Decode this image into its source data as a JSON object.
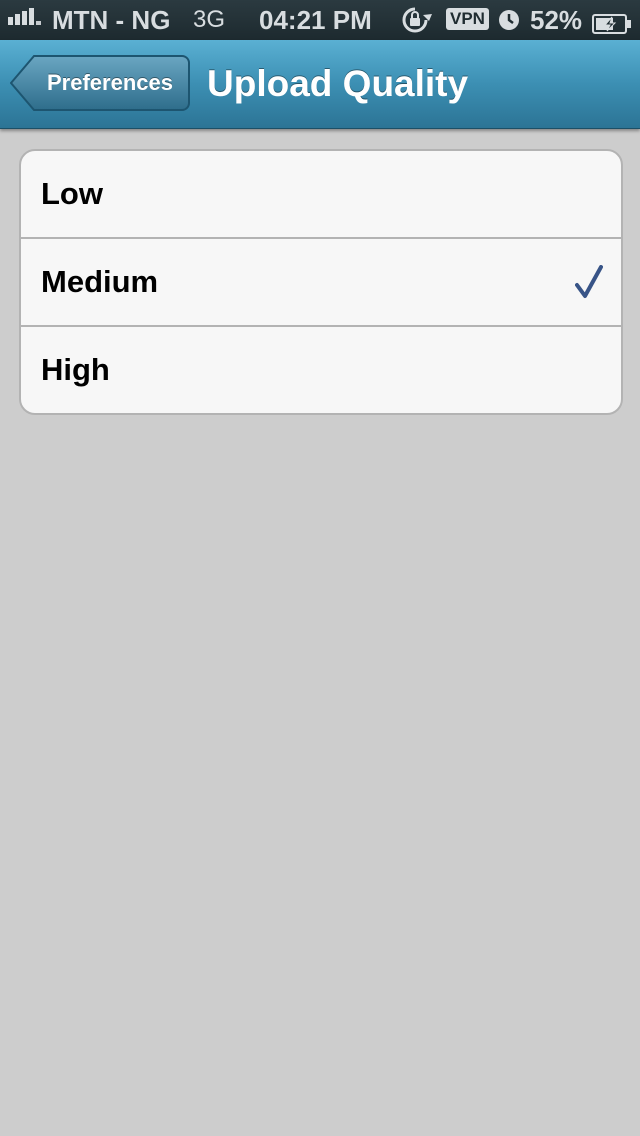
{
  "status_bar": {
    "carrier": "MTN - NG",
    "network": "3G",
    "time": "04:21 PM",
    "vpn": "VPN",
    "battery_percent": "52%",
    "icons": [
      "signal-icon",
      "rotation-lock-icon",
      "alarm-icon",
      "battery-charging-icon"
    ]
  },
  "navbar": {
    "back_label": "Preferences",
    "title": "Upload Quality"
  },
  "options": [
    {
      "label": "Low",
      "selected": false
    },
    {
      "label": "Medium",
      "selected": true
    },
    {
      "label": "High",
      "selected": false
    }
  ],
  "colors": {
    "navbar_top": "#5ab0d3",
    "navbar_bottom": "#2c7495",
    "checkmark": "#385487",
    "background": "#cdcdcd"
  }
}
